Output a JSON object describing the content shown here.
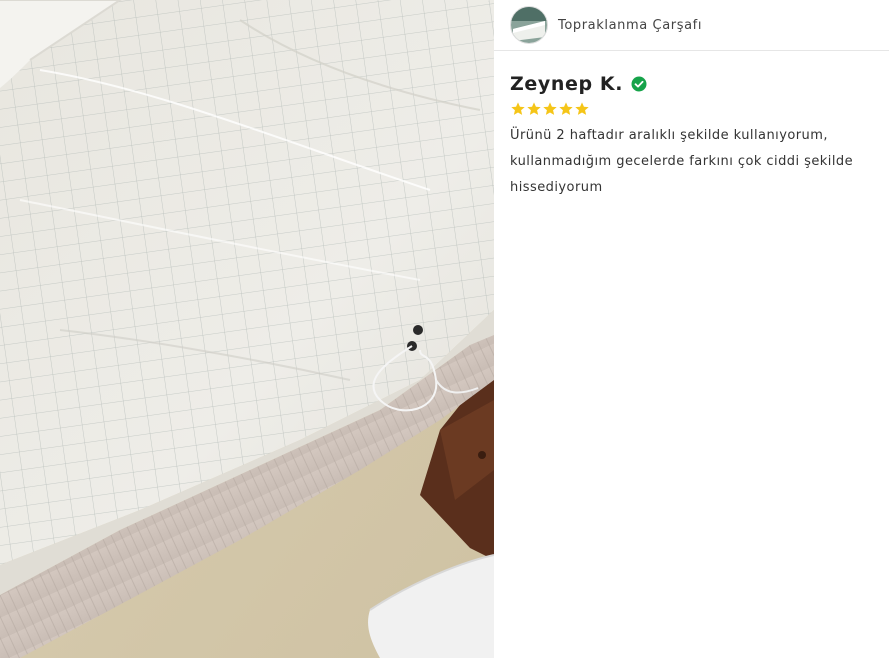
{
  "product": {
    "name": "Topraklanma Çarşafı",
    "thumbnail_icon": "product-thumbnail"
  },
  "review": {
    "reviewer": "Zeynep K.",
    "verified_icon": "verified-check-icon",
    "verified_color": "#16a34a",
    "rating": 5,
    "rating_max": 5,
    "star_color": "#f5c518",
    "text": "Ürünü 2 haftadır aralıklı şekilde kullanıyorum, kullanmadığım gecelerde farkını çok ciddi şekilde hissediyorum"
  },
  "photo": {
    "subject": "review-photo"
  }
}
